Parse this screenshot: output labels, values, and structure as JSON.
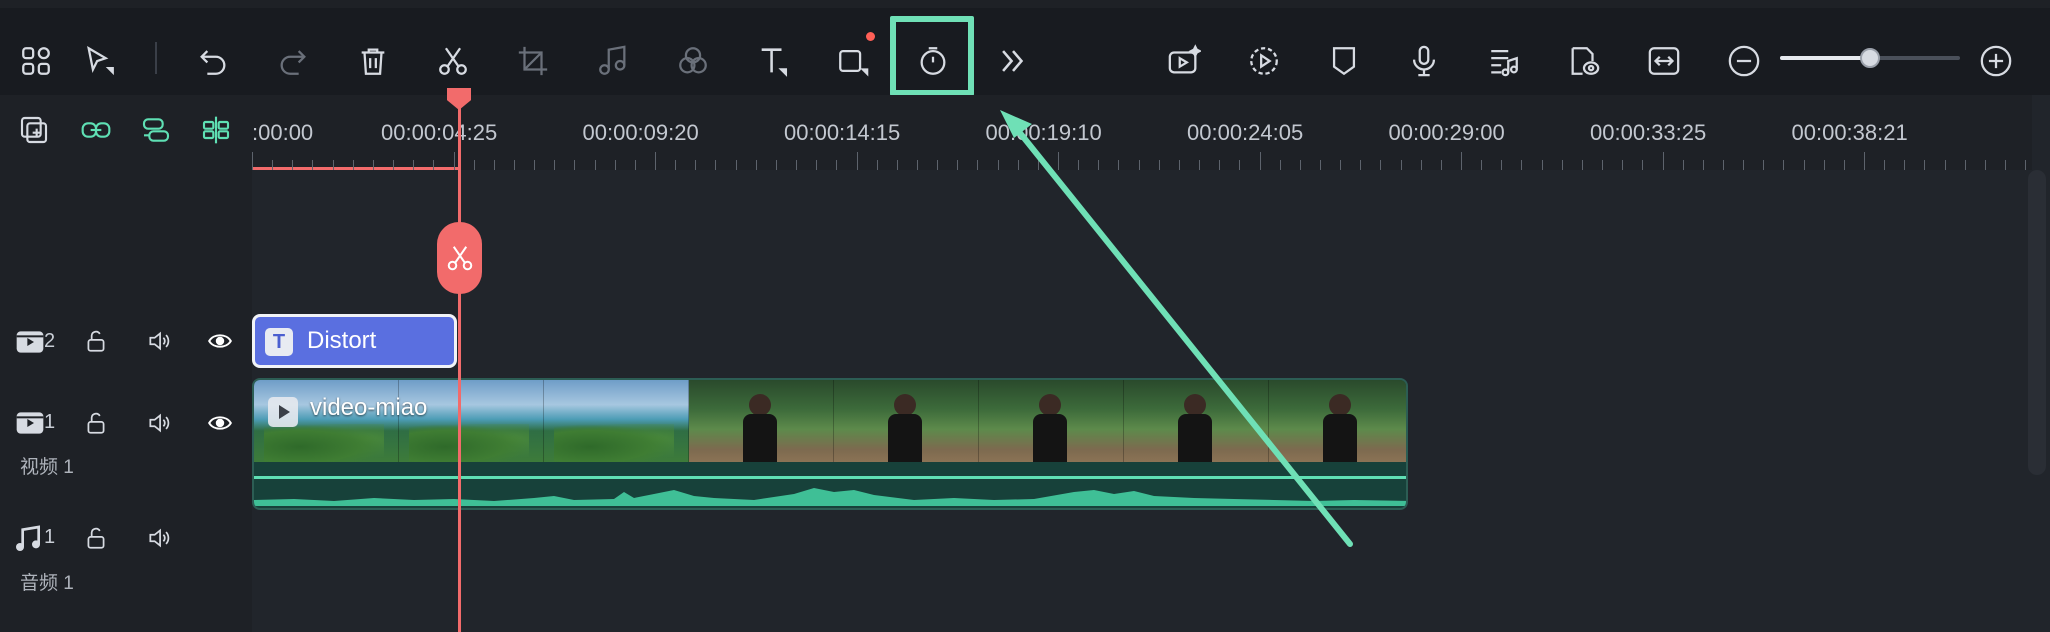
{
  "toolbar": {
    "left_tools": [
      "layout-icon",
      "select-tool-icon",
      "undo-icon",
      "redo-icon",
      "delete-icon",
      "split-icon",
      "crop-icon",
      "audio-icon",
      "color-icon",
      "text-icon",
      "shape-icon",
      "speed-duration-icon",
      "more-icon"
    ],
    "right_tools": [
      "ai-video-icon",
      "auto-reframe-icon",
      "marker-icon",
      "microphone-icon",
      "audio-mixer-icon",
      "preview-render-icon",
      "fit-timeline-icon",
      "zoom-out-icon",
      "zoom-in-icon"
    ],
    "zoom_level": 0.5
  },
  "timeline": {
    "header_tools": [
      "add-track-icon",
      "link-icon",
      "group-icon",
      "snap-icon"
    ],
    "ruler_labels": [
      ":00:00",
      "00:00:04:25",
      "00:00:09:20",
      "00:00:14:15",
      "00:00:19:10",
      "00:00:24:05",
      "00:00:29:00",
      "00:00:33:25",
      "00:00:38:21"
    ],
    "tracks": [
      {
        "number": "2",
        "name": ""
      },
      {
        "number": "1",
        "name": "视频 1"
      },
      {
        "number": "1",
        "name": "音频 1"
      }
    ],
    "clips": {
      "title": "Distort",
      "title_icon": "T",
      "video": "video-miao"
    }
  },
  "colors": {
    "accent": "#6fe0b6",
    "playhead": "#f26b6b",
    "title_clip": "#5a6fe0",
    "video_clip": "#17413a"
  }
}
